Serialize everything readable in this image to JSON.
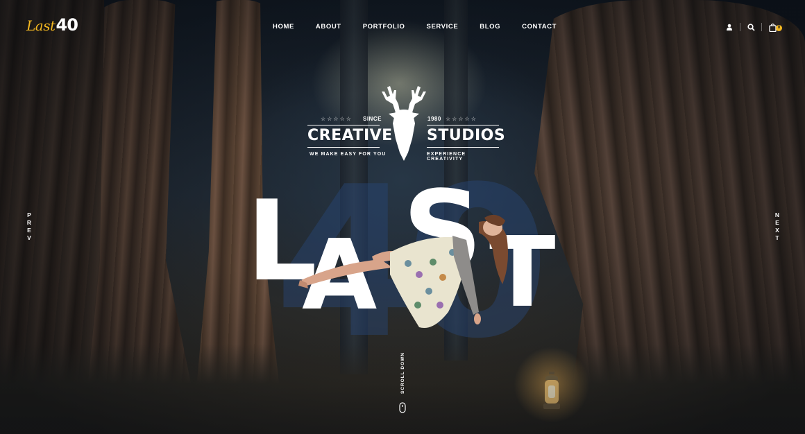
{
  "brand": {
    "logo_script": "Last",
    "logo_number": "40"
  },
  "nav": {
    "items": [
      "HOME",
      "ABOUT",
      "PORTFOLIO",
      "SERVICE",
      "BLOG",
      "CONTACT"
    ]
  },
  "header_icons": {
    "user": "user-icon",
    "search": "search-icon",
    "cart": "cart-icon",
    "cart_count": "0"
  },
  "emblem": {
    "stars_left": "☆☆☆☆☆",
    "stars_right": "☆☆☆☆☆",
    "since": "SINCE",
    "year": "1980",
    "word_left": "CREATIVE",
    "word_right": "STUDIOS",
    "tagline_left": "WE MAKE EASY FOR YOU",
    "tagline_right": "EXPERIENCE CREATIVITY",
    "icon": "deer-head-icon"
  },
  "hero": {
    "word": "LAST",
    "background_number": "40"
  },
  "side_nav": {
    "prev": "PREV",
    "next": "NEXT"
  },
  "scroll": {
    "label": "SCROLL DOWN",
    "icon": "mouse-icon"
  },
  "colors": {
    "accent": "#f5b921",
    "text": "#ffffff",
    "number_overlay": "#284678"
  }
}
